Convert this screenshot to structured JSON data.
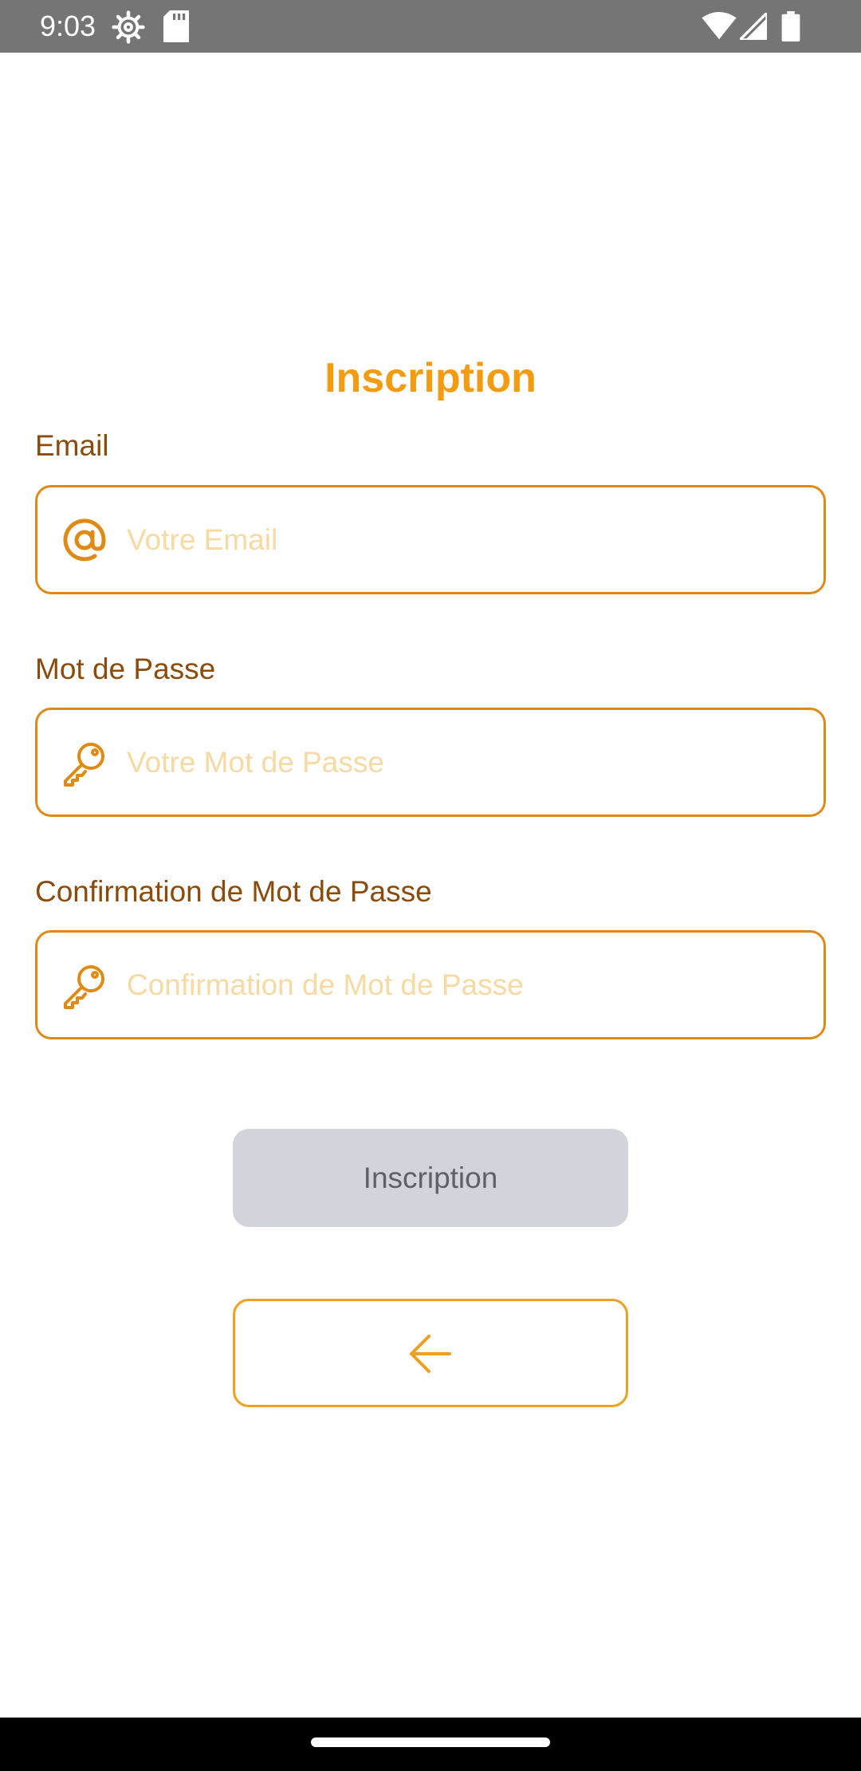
{
  "status_bar": {
    "time": "9:03",
    "icons": [
      "settings-icon",
      "sd-card-icon",
      "wifi-icon",
      "cell-signal-icon",
      "battery-icon"
    ]
  },
  "page": {
    "title": "Inscription"
  },
  "form": {
    "email": {
      "label": "Email",
      "placeholder": "Votre Email",
      "value": "",
      "icon": "at-sign-icon"
    },
    "password": {
      "label": "Mot de Passe",
      "placeholder": "Votre Mot de Passe",
      "value": "",
      "icon": "key-icon"
    },
    "confirm_password": {
      "label": "Confirmation de Mot de Passe",
      "placeholder": "Confirmation de Mot de Passe",
      "value": "",
      "icon": "key-icon"
    },
    "submit_label": "Inscription",
    "back_icon": "arrow-left-icon"
  },
  "colors": {
    "accent": "#f39c12",
    "label": "#8a4b0b",
    "border": "#e08a16",
    "placeholder": "#f8d9a2",
    "button_disabled_bg": "#d1d4db",
    "status_bar": "#757575"
  }
}
